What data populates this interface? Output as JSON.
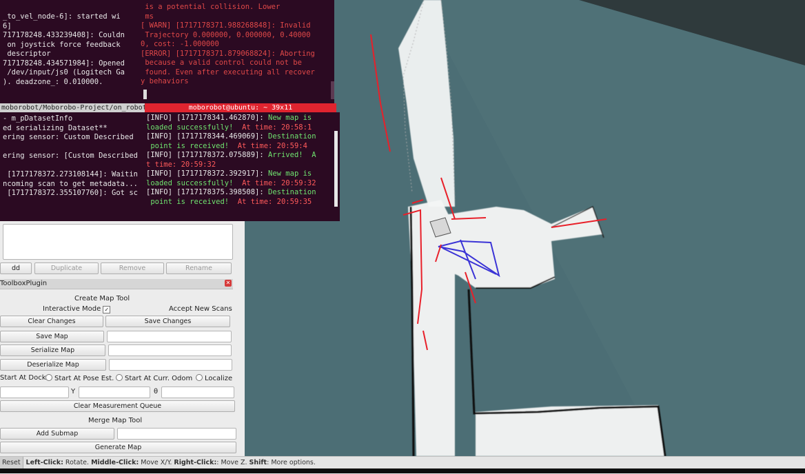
{
  "terminals": {
    "top_left": [
      {
        "text": "_to_vel_node-6]: started wi",
        "cls": "info-w"
      },
      {
        "text": "6]",
        "cls": "info-w"
      },
      {
        "text": "717178248.433239408]: Couldn",
        "cls": "info-w"
      },
      {
        "text": " on joystick force feedback",
        "cls": "info-w"
      },
      {
        "text": " descriptor",
        "cls": "info-w"
      },
      {
        "text": "717178248.434571984]: Opened",
        "cls": "info-w"
      },
      {
        "text": " /dev/input/js0 (Logitech Ga",
        "cls": "info-w"
      },
      {
        "text": "). deadzone_: 0.010000.",
        "cls": "info-w"
      }
    ],
    "top_right": [
      {
        "text": " is a potential collision. Lower",
        "cls": "warn"
      },
      {
        "text": " ms",
        "cls": "warn"
      },
      {
        "text": "[ WARN] [1717178371.988268848]: Invalid",
        "cls": "warn"
      },
      {
        "text": " Trajectory 0.000000, 0.000000, 0.40000",
        "cls": "warn"
      },
      {
        "text": "0, cost: -1.000000",
        "cls": "warn"
      },
      {
        "text": "[ERROR] [1717178371.879068824]: Aborting",
        "cls": "warn"
      },
      {
        "text": " because a valid control could not be",
        "cls": "warn"
      },
      {
        "text": " found. Even after executing all recover",
        "cls": "warn"
      },
      {
        "text": "y behaviors",
        "cls": "warn"
      }
    ],
    "bottom_left": [
      {
        "text": "- m_pDatasetInfo",
        "cls": "info-w"
      },
      {
        "text": "ed serializing Dataset**",
        "cls": "info-w"
      },
      {
        "text": "ering sensor: Custom Described",
        "cls": "info-w"
      },
      {
        "text": "",
        "cls": "info-w"
      },
      {
        "text": "ering sensor: [Custom Described",
        "cls": "info-w"
      },
      {
        "text": "",
        "cls": "info-w"
      },
      {
        "text": " [1717178372.273108144]: Waitin",
        "cls": "info-w"
      },
      {
        "text": "ncoming scan to get metadata...",
        "cls": "info-w"
      },
      {
        "text": " [1717178372.355107760]: Got sc",
        "cls": "info-w"
      }
    ],
    "bottom_right": [
      {
        "parts": [
          {
            "t": "[INFO] [1717178341.462870]: ",
            "c": "info-w"
          },
          {
            "t": "New map is",
            "c": "info-g"
          }
        ]
      },
      {
        "parts": [
          {
            "t": "loaded successfully!  ",
            "c": "info-g"
          },
          {
            "t": "At time: 20:58:1",
            "c": "info-r"
          }
        ]
      },
      {
        "parts": [
          {
            "t": "[INFO] [1717178344.469069]: ",
            "c": "info-w"
          },
          {
            "t": "Destination",
            "c": "info-g"
          }
        ]
      },
      {
        "parts": [
          {
            "t": " point is received!  ",
            "c": "info-g"
          },
          {
            "t": "At time: 20:59:4",
            "c": "info-r"
          }
        ]
      },
      {
        "parts": [
          {
            "t": "[INFO] [1717178372.075889]: ",
            "c": "info-w"
          },
          {
            "t": "Arrived!  A",
            "c": "info-g"
          }
        ]
      },
      {
        "parts": [
          {
            "t": "t time: 20:59:32",
            "c": "info-r"
          }
        ]
      },
      {
        "parts": [
          {
            "t": "[INFO] [1717178372.392917]: ",
            "c": "info-w"
          },
          {
            "t": "New map is",
            "c": "info-g"
          }
        ]
      },
      {
        "parts": [
          {
            "t": "loaded successfully!  ",
            "c": "info-g"
          },
          {
            "t": "At time: 20:59:32",
            "c": "info-r"
          }
        ]
      },
      {
        "parts": [
          {
            "t": "[INFO] [1717178375.398508]: ",
            "c": "info-w"
          },
          {
            "t": "Destination",
            "c": "info-g"
          }
        ]
      },
      {
        "parts": [
          {
            "t": " point is received!  ",
            "c": "info-g"
          },
          {
            "t": "At time: 20:59:35",
            "c": "info-r"
          }
        ]
      }
    ],
    "left_title": "moborobot/Moborobo-Project/on_robot/",
    "right_title": "moborobot@ubuntu: ~ 39x11"
  },
  "panel": {
    "top_buttons": {
      "add": "dd",
      "duplicate": "Duplicate",
      "remove": "Remove",
      "rename": "Rename"
    },
    "plugin_title": "ToolboxPlugin",
    "create_map_tool": "Create Map Tool",
    "interactive_mode": "Interactive Mode",
    "accept_new_scans": "Accept New Scans",
    "clear_changes": "Clear Changes",
    "save_changes": "Save Changes",
    "save_map": "Save Map",
    "serialize_map": "Serialize Map",
    "deserialize_map": "Deserialize Map",
    "radio_dock": "Start At Dock",
    "radio_pose": "Start At Pose Est.",
    "radio_odom": "Start At Curr. Odom",
    "radio_localize": "Localize",
    "y_label": "Y",
    "theta_label": "θ",
    "clear_queue": "Clear Measurement Queue",
    "merge_map_tool": "Merge Map Tool",
    "add_submap": "Add Submap",
    "generate_map": "Generate Map"
  },
  "statusbar": {
    "reset": "Reset",
    "left_click": "Left-Click:",
    "left_desc": " Rotate. ",
    "middle_click": "Middle-Click:",
    "middle_desc": " Move X/Y. ",
    "right_click": "Right-Click:",
    "right_desc": ": Move Z. ",
    "shift": "Shift",
    "shift_desc": ": More options."
  },
  "colors": {
    "terminal_bg": "#2b0a22",
    "map_bg": "#4a6b72",
    "title_active": "#e0242f",
    "path_red": "#e8202a",
    "path_blue": "#3b34d6"
  }
}
